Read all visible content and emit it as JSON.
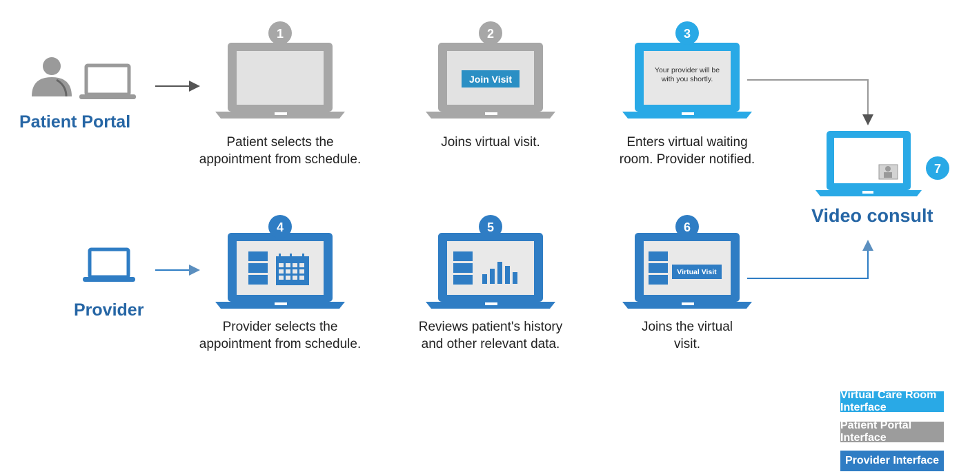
{
  "colors": {
    "patient_gray": "#a7a7a7",
    "patient_gray_dark": "#8a8a8a",
    "provider_blue": "#2f7dc4",
    "virtual_cyan": "#29a9e6",
    "actor_text": "#2666a5",
    "arrow": "#555555"
  },
  "actors": {
    "patient": "Patient Portal",
    "provider": "Provider",
    "video": "Video consult"
  },
  "steps": [
    {
      "num": "1",
      "interface": "patient",
      "label": "Patient selects the\nappointment from schedule."
    },
    {
      "num": "2",
      "interface": "patient",
      "label": "Joins virtual visit.",
      "screen_button": "Join Visit"
    },
    {
      "num": "3",
      "interface": "virtual",
      "label": "Enters virtual waiting\nroom. Provider notified.",
      "screen_text": "Your provider will be\nwith you shortly."
    },
    {
      "num": "4",
      "interface": "provider",
      "label": "Provider selects the\nappointment from schedule."
    },
    {
      "num": "5",
      "interface": "provider",
      "label": "Reviews patient's history\nand other relevant data."
    },
    {
      "num": "6",
      "interface": "provider",
      "label": "Joins the virtual\nvisit.",
      "screen_button": "Virtual Visit"
    },
    {
      "num": "7",
      "interface": "virtual"
    }
  ],
  "legend": [
    {
      "label": "Virtual Care Room Interface",
      "color": "#29a9e6"
    },
    {
      "label": "Patient Portal Interface",
      "color": "#9c9c9c"
    },
    {
      "label": "Provider Interface",
      "color": "#2f7dc4"
    }
  ],
  "icons": {
    "patient_avatar": "person-icon",
    "patient_laptop": "laptop-icon",
    "provider_laptop": "laptop-icon"
  }
}
